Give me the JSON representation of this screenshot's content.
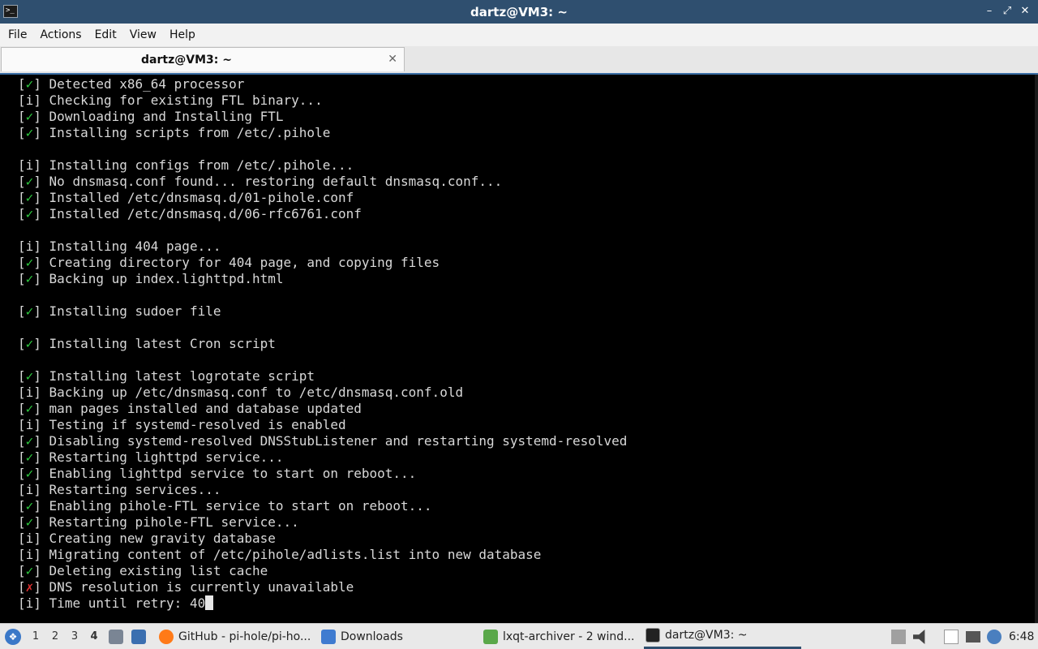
{
  "window": {
    "title": "dartz@VM3: ~",
    "app_icon_glyph": ">_",
    "minimize": "–",
    "maximize": "⤢",
    "close": "✕"
  },
  "menu": [
    "File",
    "Actions",
    "Edit",
    "View",
    "Help"
  ],
  "tab": {
    "label": "dartz@VM3: ~",
    "close": "✕"
  },
  "terminal": {
    "lines": [
      {
        "mark": "✓",
        "status": "ok",
        "text": "Detected x86_64 processor"
      },
      {
        "mark": "i",
        "status": "info",
        "text": "Checking for existing FTL binary..."
      },
      {
        "mark": "✓",
        "status": "ok",
        "text": "Downloading and Installing FTL"
      },
      {
        "mark": "✓",
        "status": "ok",
        "text": "Installing scripts from /etc/.pihole"
      },
      {
        "mark": "",
        "status": "blank",
        "text": ""
      },
      {
        "mark": "i",
        "status": "info",
        "text": "Installing configs from /etc/.pihole..."
      },
      {
        "mark": "✓",
        "status": "ok",
        "text": "No dnsmasq.conf found... restoring default dnsmasq.conf..."
      },
      {
        "mark": "✓",
        "status": "ok",
        "text": "Installed /etc/dnsmasq.d/01-pihole.conf"
      },
      {
        "mark": "✓",
        "status": "ok",
        "text": "Installed /etc/dnsmasq.d/06-rfc6761.conf"
      },
      {
        "mark": "",
        "status": "blank",
        "text": ""
      },
      {
        "mark": "i",
        "status": "info",
        "text": "Installing 404 page..."
      },
      {
        "mark": "✓",
        "status": "ok",
        "text": "Creating directory for 404 page, and copying files"
      },
      {
        "mark": "✓",
        "status": "ok",
        "text": "Backing up index.lighttpd.html"
      },
      {
        "mark": "",
        "status": "blank",
        "text": ""
      },
      {
        "mark": "✓",
        "status": "ok",
        "text": "Installing sudoer file"
      },
      {
        "mark": "",
        "status": "blank",
        "text": ""
      },
      {
        "mark": "✓",
        "status": "ok",
        "text": "Installing latest Cron script"
      },
      {
        "mark": "",
        "status": "blank",
        "text": ""
      },
      {
        "mark": "✓",
        "status": "ok",
        "text": "Installing latest logrotate script"
      },
      {
        "mark": "i",
        "status": "info",
        "text": "Backing up /etc/dnsmasq.conf to /etc/dnsmasq.conf.old"
      },
      {
        "mark": "✓",
        "status": "ok",
        "text": "man pages installed and database updated"
      },
      {
        "mark": "i",
        "status": "info",
        "text": "Testing if systemd-resolved is enabled"
      },
      {
        "mark": "✓",
        "status": "ok",
        "text": "Disabling systemd-resolved DNSStubListener and restarting systemd-resolved"
      },
      {
        "mark": "✓",
        "status": "ok",
        "text": "Restarting lighttpd service..."
      },
      {
        "mark": "✓",
        "status": "ok",
        "text": "Enabling lighttpd service to start on reboot..."
      },
      {
        "mark": "i",
        "status": "info",
        "text": "Restarting services..."
      },
      {
        "mark": "✓",
        "status": "ok",
        "text": "Enabling pihole-FTL service to start on reboot..."
      },
      {
        "mark": "✓",
        "status": "ok",
        "text": "Restarting pihole-FTL service..."
      },
      {
        "mark": "i",
        "status": "info",
        "text": "Creating new gravity database"
      },
      {
        "mark": "i",
        "status": "info",
        "text": "Migrating content of /etc/pihole/adlists.list into new database"
      },
      {
        "mark": "✓",
        "status": "ok",
        "text": "Deleting existing list cache"
      },
      {
        "mark": "✗",
        "status": "err",
        "text": "DNS resolution is currently unavailable"
      },
      {
        "mark": "i",
        "status": "info",
        "text": "Time until retry: 40",
        "cursor": true
      }
    ]
  },
  "taskbar": {
    "workspaces": [
      "1",
      "2",
      "3",
      "4"
    ],
    "active_workspace": "4",
    "tasks": [
      {
        "label": "GitHub - pi-hole/pi-ho...",
        "icon": "firefox-icon"
      },
      {
        "label": "Downloads",
        "icon": "folder-icon"
      },
      {
        "label": "lxqt-archiver - 2 wind...",
        "icon": "archive-icon"
      },
      {
        "label": "dartz@VM3: ~",
        "icon": "terminal-icon",
        "active": true
      }
    ],
    "clock": "6:48",
    "colors": {
      "ok": "#2ecc40",
      "err": "#e03131",
      "title_bar": "#2f4f6f"
    }
  }
}
